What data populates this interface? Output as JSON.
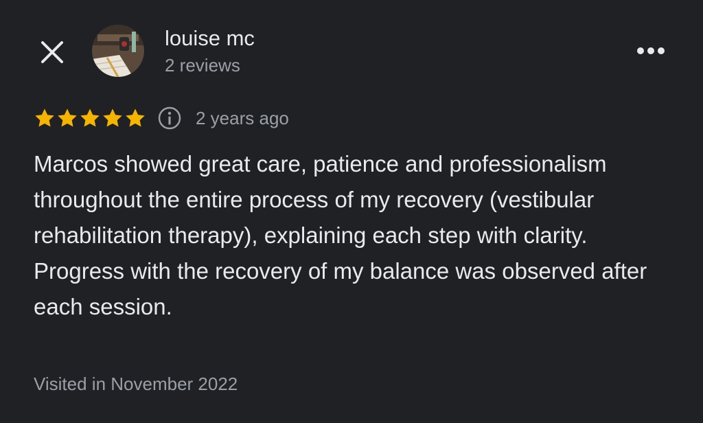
{
  "header": {
    "reviewer_name": "louise mc",
    "review_count": "2 reviews",
    "avatar_icon": "profile-photo",
    "close_icon": "close-icon",
    "more_icon": "more-options-icon"
  },
  "rating": {
    "stars": 5,
    "max_stars": 5,
    "star_color": "#f4b400",
    "time_ago": "2 years ago",
    "info_icon": "info-icon"
  },
  "review": {
    "text": "Marcos showed great care, patience and professionalism throughout the entire process of my recovery (vestibular rehabilitation therapy), explaining each step with clarity. Progress with the recovery of my balance was observed after each session."
  },
  "footer": {
    "visited": "Visited in November 2022"
  },
  "colors": {
    "background": "#202124",
    "primary_text": "#e8eaed",
    "secondary_text": "#9aa0a6"
  }
}
